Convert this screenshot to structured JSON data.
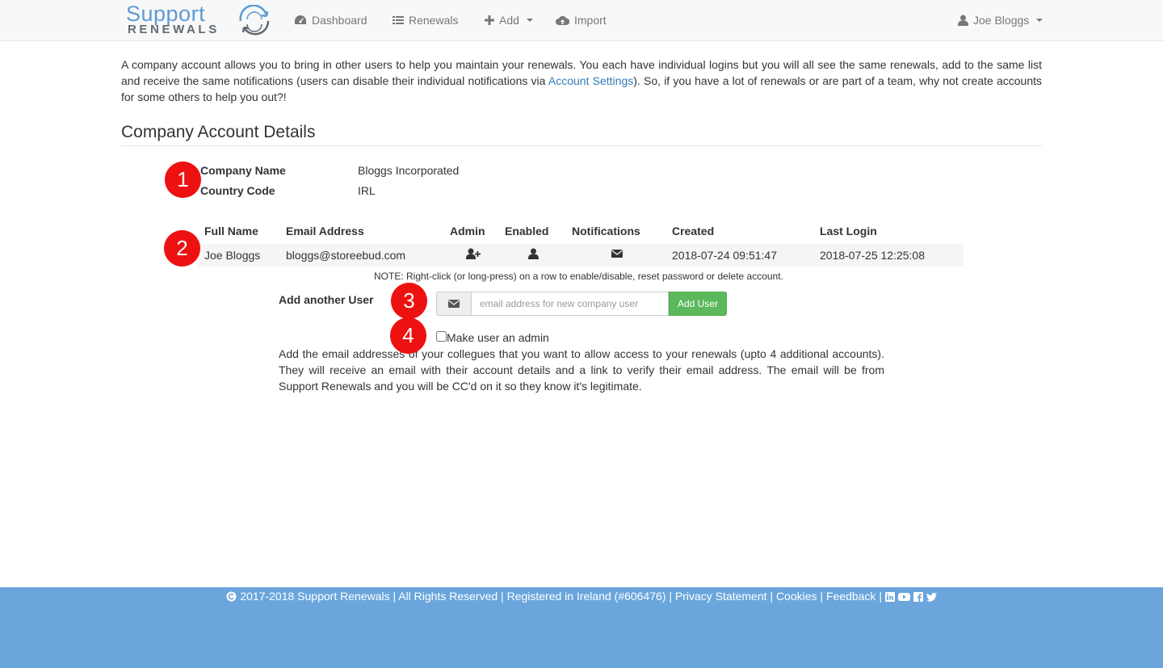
{
  "navbar": {
    "logo": {
      "line1": "Support",
      "line2": "RENEWALS"
    },
    "items": [
      {
        "label": "Dashboard",
        "icon": "dashboard-icon"
      },
      {
        "label": "Renewals",
        "icon": "list-icon"
      },
      {
        "label": "Add",
        "icon": "plus-icon"
      },
      {
        "label": "Import",
        "icon": "cloud-upload-icon"
      }
    ],
    "user": {
      "label": "Joe Bloggs",
      "icon": "user-icon"
    }
  },
  "intro": {
    "text_before": "A company account allows you to bring in other users to help you maintain your renewals. You each have individual logins but you will all see the same renewals, add to the same list and receive the same notifications (users can disable their individual notifications via ",
    "link": "Account Settings",
    "text_after": "). So, if you have a lot of renewals or are part of a team, why not create accounts for some others to help you out?!"
  },
  "section_title": "Company Account Details",
  "company": {
    "name_label": "Company Name",
    "name_value": "Bloggs Incorporated",
    "country_label": "Country Code",
    "country_value": "IRL"
  },
  "users_table": {
    "headers": [
      "Full Name",
      "Email Address",
      "Admin",
      "Enabled",
      "Notifications",
      "Created",
      "Last Login"
    ],
    "rows": [
      {
        "full_name": "Joe Bloggs",
        "email": "bloggs@storeebud.com",
        "admin_icon": "user-plus-icon",
        "enabled_icon": "user-icon",
        "notifications_icon": "envelope-icon",
        "created": "2018-07-24 09:51:47",
        "last_login": "2018-07-25 12:25:08"
      }
    ],
    "note": "NOTE: Right-click (or long-press) on a row to enable/disable, reset password or delete account."
  },
  "add_user": {
    "label": "Add another User",
    "placeholder": "email address for new company user",
    "button": "Add User",
    "admin_checkbox_label": "Make user an admin",
    "help": "Add the email addresses of your collegues that you want to allow access to your renewals (upto 4 additional accounts). They will receive an email with their account details and a link to verify their email address. The email will be from Support Renewals and you will be CC'd on it so they know it's legitimate."
  },
  "markers": [
    "1",
    "2",
    "3",
    "4"
  ],
  "footer": {
    "copyright": "2017-2018 Support Renewals | All Rights Reserved | Registered in Ireland (#606476) |",
    "links": [
      "Privacy Statement",
      "Cookies",
      "Feedback"
    ],
    "social_icons": [
      "linkedin-icon",
      "youtube-icon",
      "facebook-icon",
      "twitter-icon"
    ]
  },
  "colors": {
    "link": "#337ab7",
    "success_button": "#5cb85c",
    "marker": "#ee1111",
    "footer_bg": "#6aa6dc",
    "logo_blue": "#5b9bd5"
  }
}
